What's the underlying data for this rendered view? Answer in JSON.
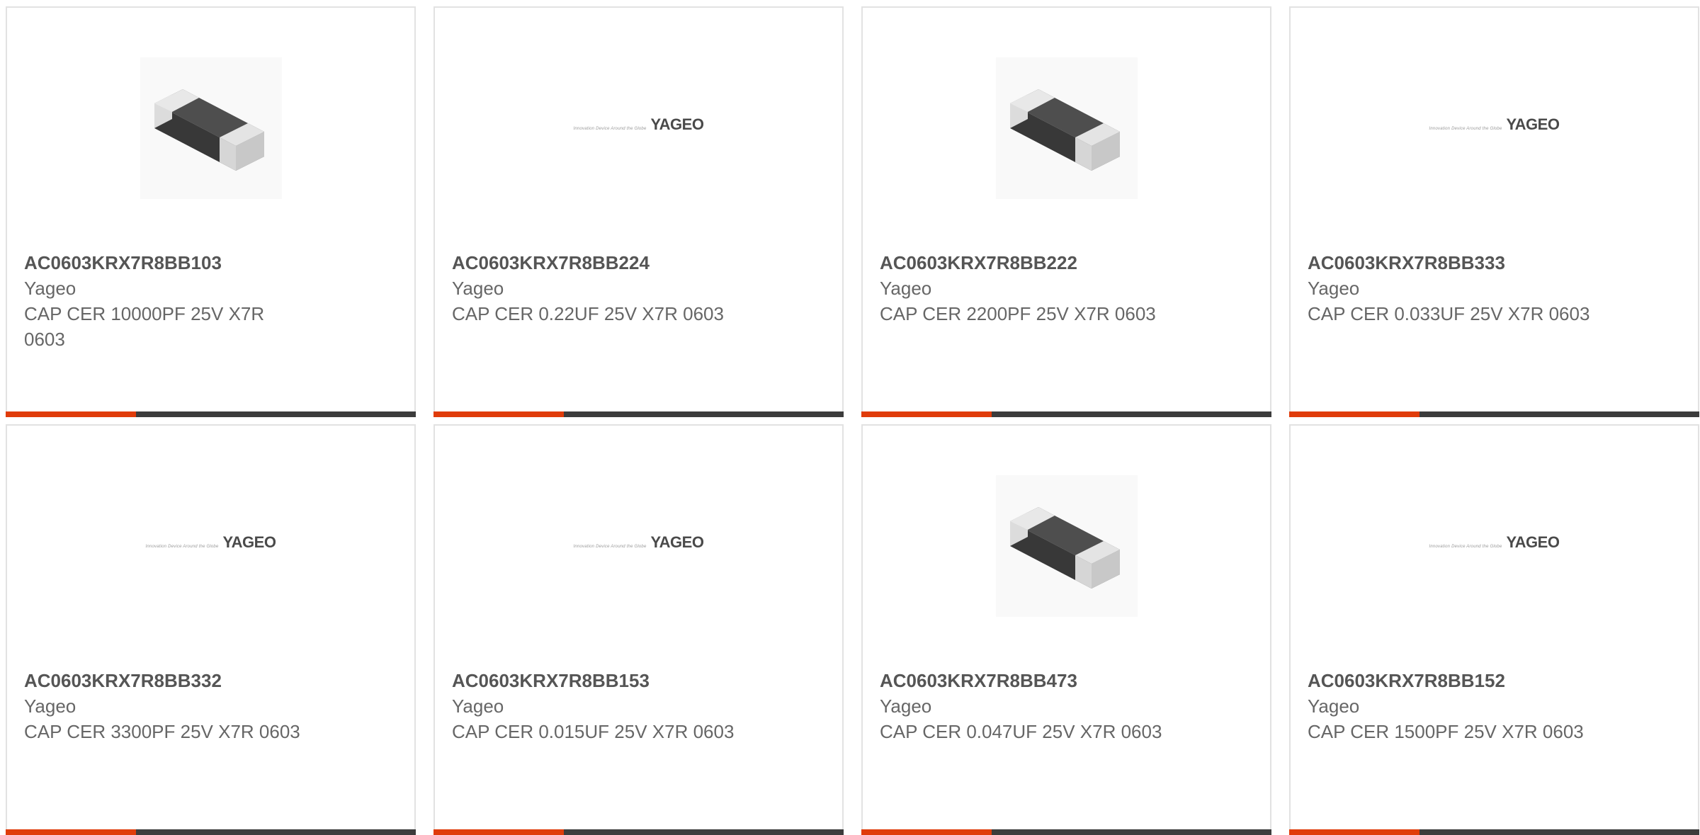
{
  "colors": {
    "accent": "#e03c0a",
    "bar_dark": "#3c3c3c",
    "border": "#e2e2e2"
  },
  "logo": {
    "tagline": "Innovation Device Around the Globe",
    "word": "YAGEO"
  },
  "products": [
    {
      "part": "AC0603KRX7R8BB103",
      "manufacturer": "Yageo",
      "description": "CAP CER 10000PF 25V X7R 0603",
      "image": "chip-capacitor"
    },
    {
      "part": "AC0603KRX7R8BB224",
      "manufacturer": "Yageo",
      "description": "CAP CER 0.22UF 25V X7R 0603",
      "image": "yageo-logo"
    },
    {
      "part": "AC0603KRX7R8BB222",
      "manufacturer": "Yageo",
      "description": "CAP CER 2200PF 25V X7R 0603",
      "image": "chip-capacitor"
    },
    {
      "part": "AC0603KRX7R8BB333",
      "manufacturer": "Yageo",
      "description": "CAP CER 0.033UF 25V X7R 0603",
      "image": "yageo-logo"
    },
    {
      "part": "AC0603KRX7R8BB332",
      "manufacturer": "Yageo",
      "description": "CAP CER 3300PF 25V X7R 0603",
      "image": "yageo-logo"
    },
    {
      "part": "AC0603KRX7R8BB153",
      "manufacturer": "Yageo",
      "description": "CAP CER 0.015UF 25V X7R 0603",
      "image": "yageo-logo"
    },
    {
      "part": "AC0603KRX7R8BB473",
      "manufacturer": "Yageo",
      "description": "CAP CER 0.047UF 25V X7R 0603",
      "image": "chip-capacitor"
    },
    {
      "part": "AC0603KRX7R8BB152",
      "manufacturer": "Yageo",
      "description": "CAP CER 1500PF 25V X7R 0603",
      "image": "yageo-logo"
    }
  ]
}
